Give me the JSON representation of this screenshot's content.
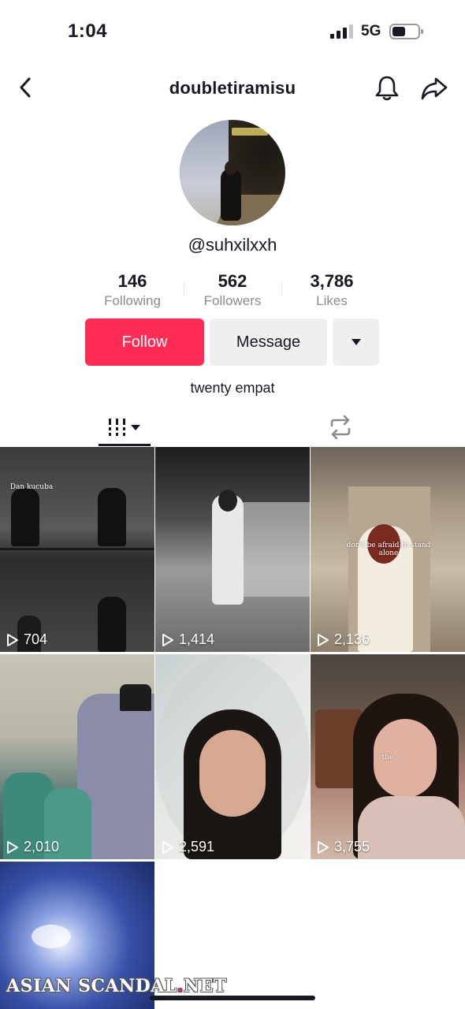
{
  "status_bar": {
    "time": "1:04",
    "network": "5G"
  },
  "header": {
    "title": "doubletiramisu"
  },
  "profile": {
    "handle": "@suhxilxxh",
    "stats": [
      {
        "value": "146",
        "label": "Following"
      },
      {
        "value": "562",
        "label": "Followers"
      },
      {
        "value": "3,786",
        "label": "Likes"
      }
    ],
    "follow_label": "Follow",
    "message_label": "Message",
    "bio": "twenty empat"
  },
  "tabs": [
    {
      "icon": "video-grid-icon",
      "active": true
    },
    {
      "icon": "repost-icon",
      "active": false
    }
  ],
  "videos": [
    {
      "views": "704",
      "overlay": "Dan kucuba"
    },
    {
      "views": "1,414",
      "overlay": ""
    },
    {
      "views": "2,136",
      "overlay": "don't be afraid to stand alone"
    },
    {
      "views": "2,010",
      "overlay": ""
    },
    {
      "views": "2,591",
      "overlay": ""
    },
    {
      "views": "3,755",
      "overlay": "the"
    },
    {
      "views": "",
      "overlay": ""
    }
  ],
  "watermark": {
    "part1": "ASIAN SCANDAL",
    "dot": ".",
    "part2": "NET"
  },
  "colors": {
    "follow": "#fe2c55",
    "secondary_button": "#efeff0",
    "text": "#161823",
    "muted": "#8a8b91"
  }
}
